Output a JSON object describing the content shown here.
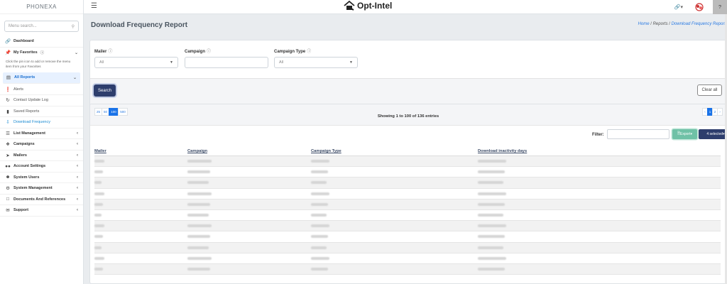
{
  "sidebar": {
    "brand": "PHONEXA",
    "search_placeholder": "Menu search...",
    "dashboard": "Dashboard",
    "favorites": "My Favorites",
    "favorites_note": "Click the pin icon to add or remove the menu item from your Favorites",
    "all_reports": "All Reports",
    "report_items": [
      "Alerts",
      "Contact Update Log",
      "Saved Reports",
      "Download Frequency"
    ],
    "groups": [
      "List Management",
      "Campaigns",
      "Mailers",
      "Account Settings",
      "System Users",
      "System Management",
      "Documents And References",
      "Support"
    ]
  },
  "topbar": {
    "logo_text": "Opt-Intel",
    "help": "?"
  },
  "page": {
    "title": "Download Frequency Report",
    "breadcrumb": {
      "home": "Home",
      "sep": "/",
      "reports": "Reports",
      "current": "Download Frequency Report"
    }
  },
  "filters": {
    "mailer_label": "Mailer",
    "mailer_value": "All",
    "campaign_label": "Campaign",
    "campaign_value": "",
    "campaign_type_label": "Campaign Type",
    "campaign_type_value": "All",
    "search_btn": "Search",
    "clear_btn": "Clear all"
  },
  "table_controls": {
    "page_lengths": [
      "25",
      "50",
      "100",
      "500"
    ],
    "active_length": "100",
    "info": "Showing 1 to 100 of 136 entries",
    "pager": [
      "‹",
      "1",
      "2",
      "›"
    ],
    "filter_label": "Filter:",
    "export_btn": "Export",
    "selected_btn": "4 selected"
  },
  "table": {
    "columns": [
      "Mailer",
      "Campaign",
      "Campaign Type",
      "Download inactivity days"
    ]
  },
  "colors": {
    "primary": "#2e3e6d",
    "active_blue": "#1a73e8",
    "export_green": "#6fc1a6"
  }
}
